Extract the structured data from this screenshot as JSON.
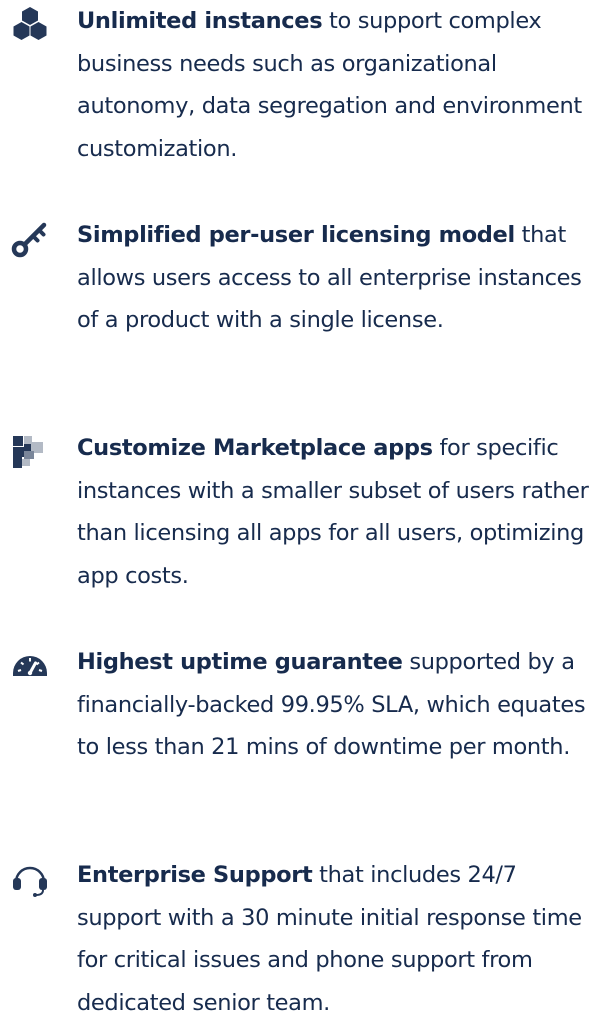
{
  "features": [
    {
      "icon": "cubes-icon",
      "title": "Unlimited instances",
      "description": " to support complex business needs such as organizational autonomy, data segregation and environment customization."
    },
    {
      "icon": "key-icon",
      "title": "Simplified per-user licensing model",
      "description": " that allows users access to all enterprise instances of a product with a single license."
    },
    {
      "icon": "puzzle-blocks-icon",
      "title": "Customize Marketplace apps",
      "description": " for specific instances with a smaller subset of users rather than licensing all apps for all users, optimizing app costs."
    },
    {
      "icon": "speedometer-icon",
      "title": "Highest uptime guarantee",
      "description": " supported by a financially-backed 99.95% SLA, which equates to less than 21 mins of downtime per month."
    },
    {
      "icon": "headset-icon",
      "title": "Enterprise Support",
      "description": " that includes 24/7 support with a 30 minute initial response time for critical issues and phone support from dedicated senior team."
    }
  ],
  "colors": {
    "text": "#172B4D",
    "icon_dark": "#253858",
    "icon_light": "#B3BAC5"
  }
}
